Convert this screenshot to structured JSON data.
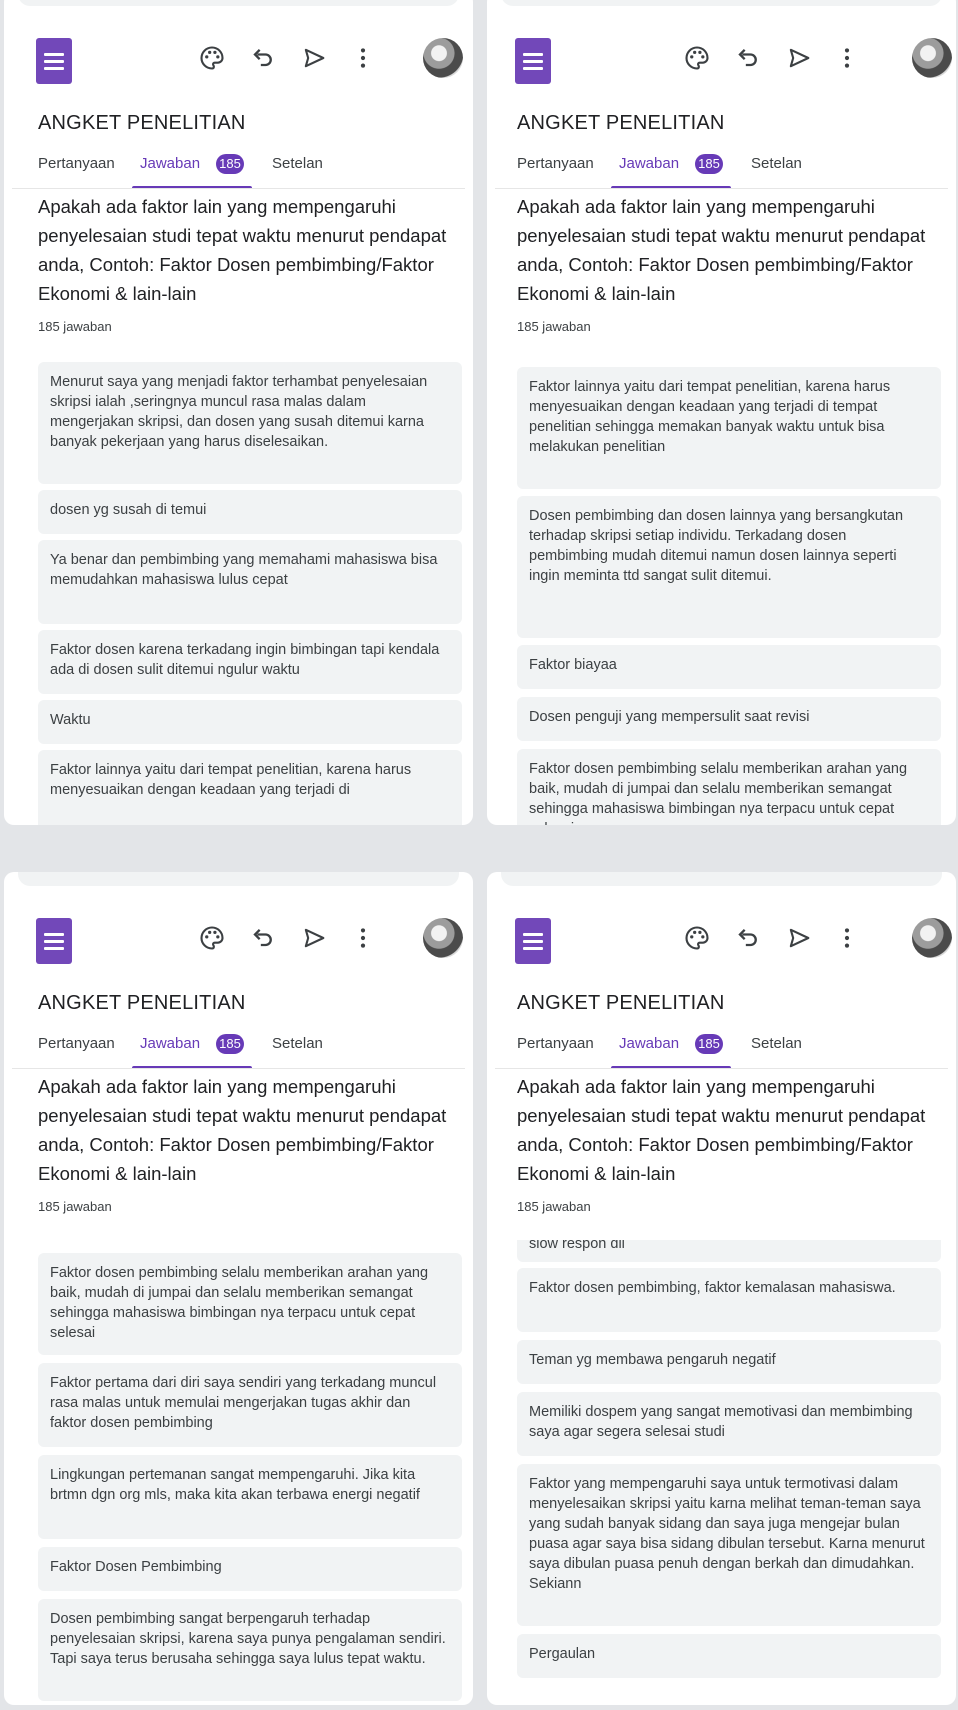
{
  "screens": [
    {
      "title": "ANGKET PENELITIAN",
      "tabs": [
        "Pertanyaan",
        "Jawaban",
        "Setelan"
      ],
      "badge": "185",
      "question": "Apakah ada faktor lain yang mempengaruhi penyelesaian studi tepat waktu menurut pendapat anda, Contoh: Faktor Dosen pembimbing/Faktor Ekonomi & lain-lain",
      "response_count": "185 jawaban",
      "responses": [
        "Menurut saya yang menjadi faktor terhambat penyelesaian skripsi ialah ,seringnya muncul rasa malas dalam mengerjakan skripsi, dan dosen yang susah ditemui karna banyak pekerjaan yang harus diselesaikan.",
        "dosen yg susah di temui",
        "Ya benar dan pembimbing yang memahami mahasiswa bisa memudahkan mahasiswa lulus cepat",
        "Faktor dosen karena terkadang ingin bimbingan tapi kendala ada di dosen sulit ditemui ngulur waktu",
        "Waktu",
        "Faktor lainnya yaitu dari tempat penelitian, karena harus menyesuaikan dengan keadaan yang terjadi di"
      ]
    },
    {
      "title": "ANGKET PENELITIAN",
      "tabs": [
        "Pertanyaan",
        "Jawaban",
        "Setelan"
      ],
      "badge": "185",
      "question": "Apakah ada faktor lain yang mempengaruhi penyelesaian studi tepat waktu menurut pendapat anda, Contoh: Faktor Dosen pembimbing/Faktor Ekonomi & lain-lain",
      "response_count": "185 jawaban",
      "responses": [
        "Faktor lainnya yaitu dari tempat penelitian, karena harus menyesuaikan dengan keadaan yang terjadi di tempat penelitian sehingga memakan banyak waktu untuk bisa melakukan penelitian",
        "Dosen pembimbing dan dosen lainnya yang bersangkutan terhadap skripsi setiap individu. Terkadang dosen pembimbing mudah ditemui namun dosen lainnya seperti ingin meminta ttd sangat sulit ditemui.",
        "Faktor biayaa",
        "Dosen penguji yang mempersulit saat revisi",
        "Faktor dosen pembimbing selalu memberikan arahan yang baik, mudah di jumpai dan selalu memberikan semangat sehingga mahasiswa bimbingan nya terpacu untuk cepat selesai"
      ]
    },
    {
      "title": "ANGKET PENELITIAN",
      "tabs": [
        "Pertanyaan",
        "Jawaban",
        "Setelan"
      ],
      "badge": "185",
      "question": "Apakah ada faktor lain yang mempengaruhi penyelesaian studi tepat waktu menurut pendapat anda, Contoh: Faktor Dosen pembimbing/Faktor Ekonomi & lain-lain",
      "response_count": "185 jawaban",
      "responses": [
        "Faktor dosen pembimbing selalu memberikan arahan yang baik, mudah di jumpai dan selalu memberikan semangat sehingga mahasiswa bimbingan nya terpacu untuk cepat selesai",
        "Faktor pertama dari diri saya sendiri yang terkadang muncul rasa malas untuk memulai mengerjakan tugas akhir dan faktor dosen pembimbing",
        "Lingkungan pertemanan sangat mempengaruhi. Jika kita brtmn dgn org mls, maka kita akan terbawa energi negatif",
        "Faktor Dosen Pembimbing",
        "Dosen pembimbing sangat berpengaruh terhadap penyelesaian skripsi, karena saya punya pengalaman sendiri. Tapi saya terus berusaha sehingga saya lulus tepat waktu."
      ]
    },
    {
      "title": "ANGKET PENELITIAN",
      "tabs": [
        "Pertanyaan",
        "Jawaban",
        "Setelan"
      ],
      "badge": "185",
      "question": "Apakah ada faktor lain yang mempengaruhi penyelesaian studi tepat waktu menurut pendapat anda, Contoh: Faktor Dosen pembimbing/Faktor Ekonomi & lain-lain",
      "response_count": "185 jawaban",
      "responses": [
        "slow respon dll",
        "Faktor dosen pembimbing, faktor kemalasan mahasiswa.",
        "Teman yg membawa pengaruh negatif",
        "Memiliki dospem yang sangat memotivasi dan membimbing saya agar segera selesai studi",
        "Faktor yang mempengaruhi saya untuk termotivasi dalam menyelesaikan skripsi yaitu karna melihat teman-teman saya yang sudah banyak sidang dan saya juga mengejar bulan puasa agar saya bisa sidang dibulan tersebut. Karna menurut saya dibulan puasa penuh dengan berkah dan dimudahkan. Sekiann",
        "Pergaulan"
      ]
    }
  ],
  "icons": {
    "app": "google-forms-icon",
    "palette": "palette-icon",
    "undo": "undo-icon",
    "send": "send-icon",
    "more": "more-vert-icon",
    "avatar": "avatar"
  },
  "colors": {
    "accent": "#673ab7",
    "logo": "#7248b9",
    "card": "#f1f3f4",
    "page": "#ffffff"
  }
}
